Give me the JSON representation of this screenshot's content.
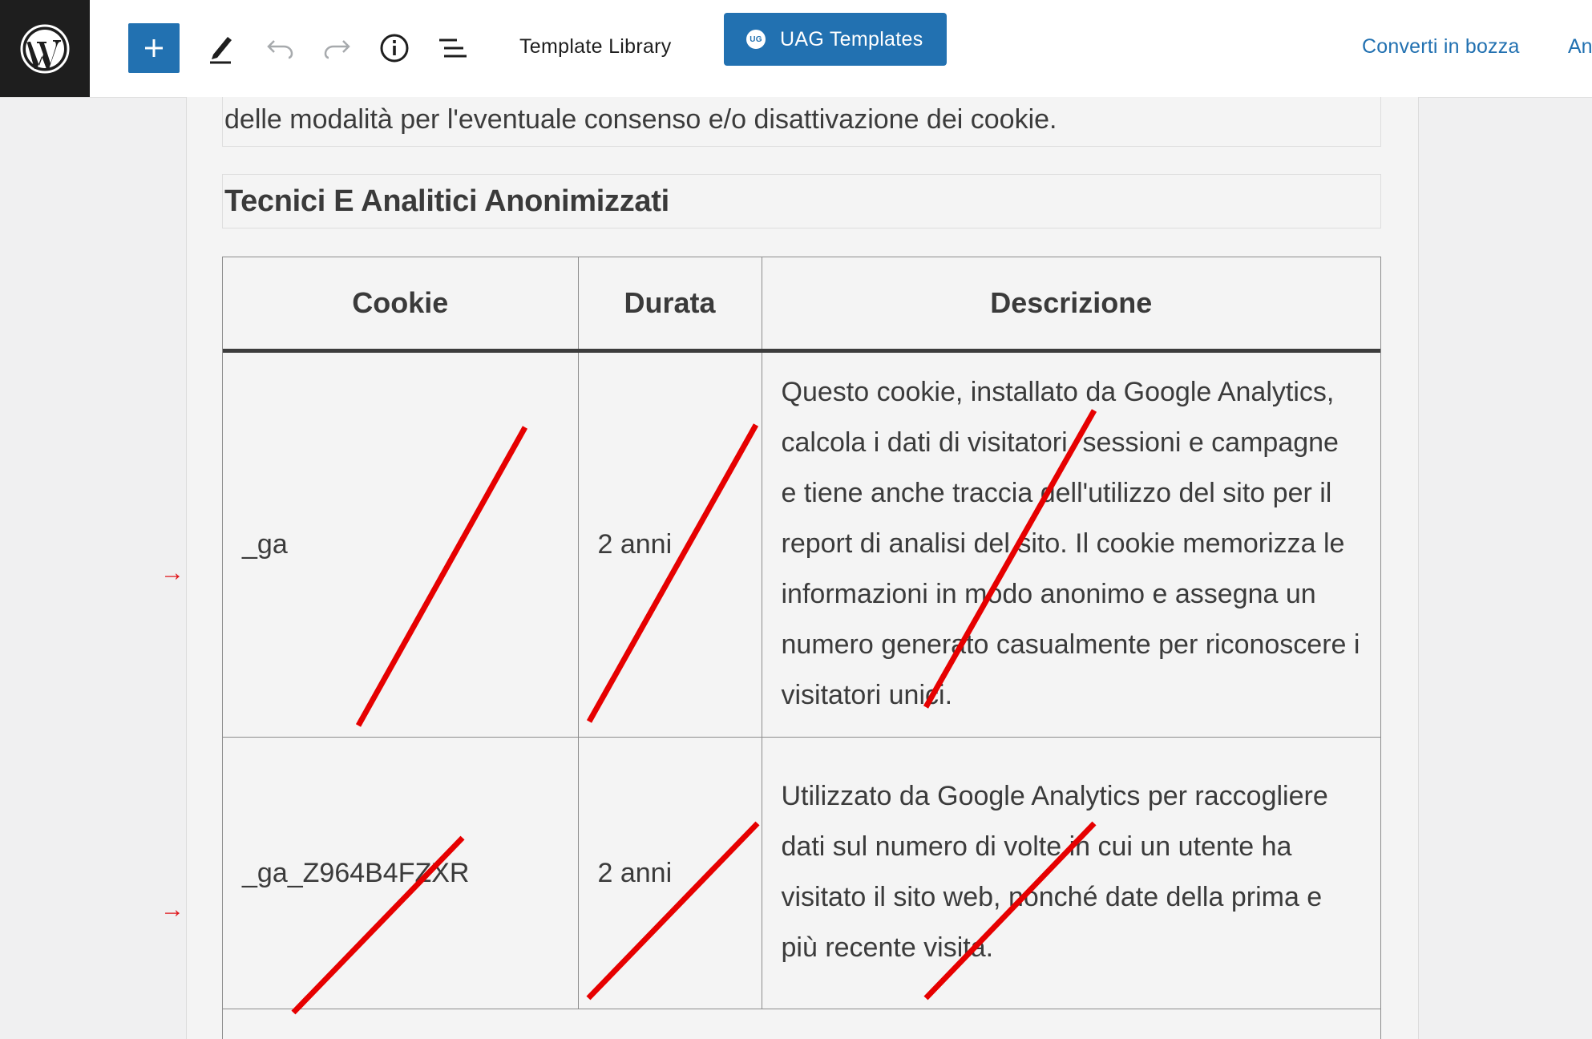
{
  "toolbar": {
    "template_library": "Template Library",
    "uag_badge": "UG",
    "uag_templates": "UAG Templates",
    "convert_to_draft": "Converti in bozza",
    "preview_partial": "An"
  },
  "content": {
    "paragraph": "delle modalità per l'eventuale consenso e/o disattivazione dei cookie.",
    "heading": "Tecnici E Analitici Anonimizzati"
  },
  "table": {
    "headers": [
      "Cookie",
      "Durata",
      "Descrizione"
    ],
    "rows": [
      {
        "cookie": "_ga",
        "duration": "2 anni",
        "description": "Questo cookie, installato da Google Analytics, calcola i dati di visitatori, sessioni e campagne e tiene anche traccia dell'utilizzo del sito per il report di analisi del sito. Il cookie memorizza le informazioni in modo anonimo e assegna un numero generato casualmente per riconoscere i visitatori unici."
      },
      {
        "cookie": "_ga_Z964B4FZXR",
        "duration": "2 anni",
        "description": "Utilizzato da Google Analytics per raccogliere dati sul numero di volte in cui un utente ha visitato il sito web, nonché date della prima e più recente visita."
      }
    ]
  },
  "annotations": {
    "arrow_glyph": "→",
    "mark_color": "#e60000"
  },
  "colors": {
    "accent": "#2271b1",
    "wp_logo_bg": "#1e1e1e"
  }
}
